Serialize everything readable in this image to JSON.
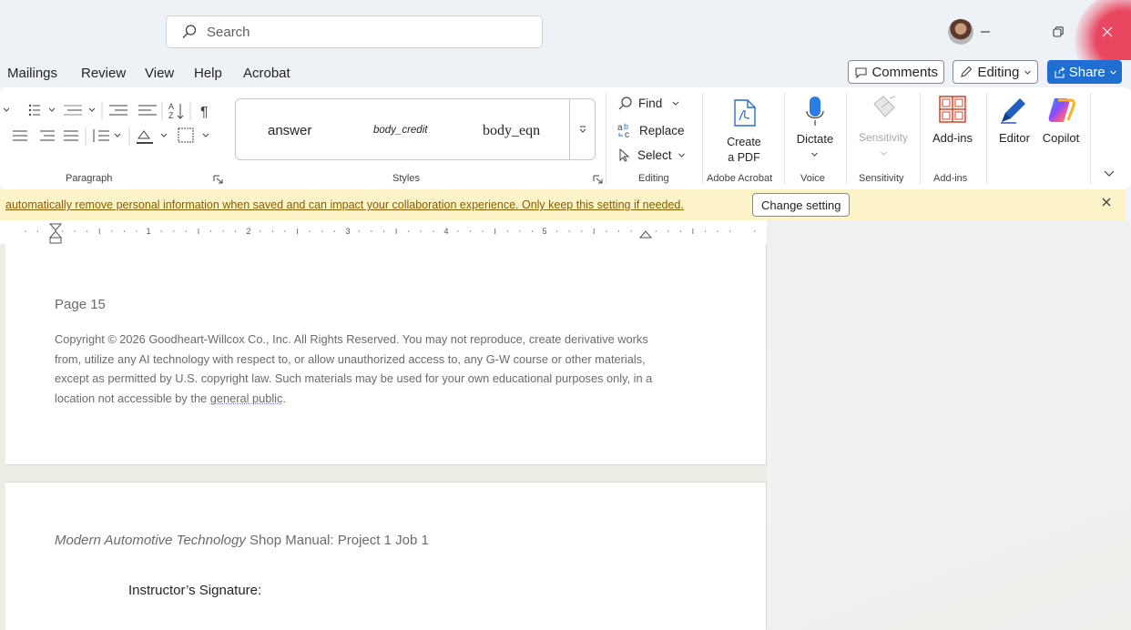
{
  "titlebar": {
    "search_placeholder": "Search"
  },
  "tabs": [
    "Mailings",
    "Review",
    "View",
    "Help",
    "Acrobat"
  ],
  "top_buttons": {
    "comments": "Comments",
    "editing": "Editing",
    "share": "Share"
  },
  "ribbon": {
    "paragraph_label": "Paragraph",
    "styles": {
      "label": "Styles",
      "items": [
        "answer",
        "body_credit",
        "body_eqn"
      ]
    },
    "editing": {
      "label": "Editing",
      "find": "Find",
      "replace": "Replace",
      "select": "Select"
    },
    "acrobat": {
      "button": [
        "Create",
        "a PDF"
      ],
      "label": "Adobe Acrobat"
    },
    "voice": {
      "button": "Dictate",
      "label": "Voice"
    },
    "sensitivity": {
      "button": "Sensitivity",
      "label": "Sensitivity"
    },
    "addins": {
      "button": "Add-ins",
      "label": "Add-ins"
    },
    "editor": "Editor",
    "copilot": "Copilot"
  },
  "infobar": {
    "message": "automatically remove personal information when saved and can impact your collaboration experience. Only keep this setting if needed.",
    "button": "Change setting"
  },
  "ruler": {
    "numbers": [
      "1",
      "2",
      "3",
      "4",
      "5"
    ]
  },
  "document": {
    "page1": {
      "header": "Page 15",
      "copyright": "Copyright © 2026 Goodheart-Willcox Co., Inc. All Rights Reserved. You may not reproduce, create derivative works from, utilize any AI technology with respect to, or allow unauthorized access to, any G-W course or other materials, except as permitted by U.S. copyright law. Such materials may be used for your own educational purposes only, in a location not accessible by the",
      "copyright_end": "general public",
      "copyright_period": "."
    },
    "page2": {
      "header_italic": "Modern Automotive Technology",
      "header_rest": " Shop Manual: Project 1 Job 1",
      "signature_label": "Instructor’s Signature:"
    }
  },
  "colors": {
    "share_button": "#1f6fd0",
    "infobar_bg": "#fcf4c8",
    "close_hover": "#e82846"
  }
}
